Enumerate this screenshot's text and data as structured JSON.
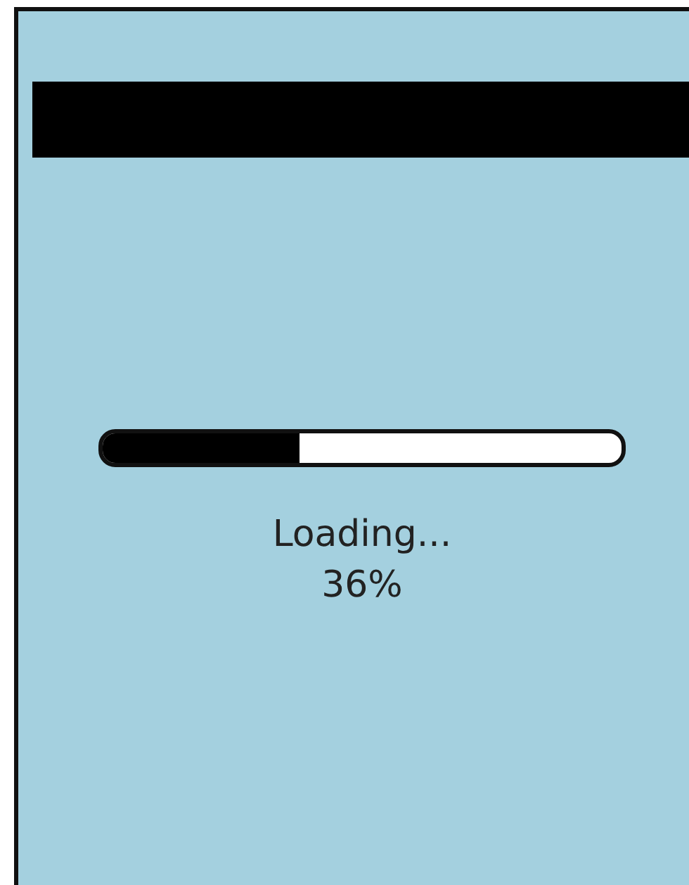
{
  "progress": {
    "level": 0.38,
    "label": "Loading...",
    "percent": "36%"
  }
}
